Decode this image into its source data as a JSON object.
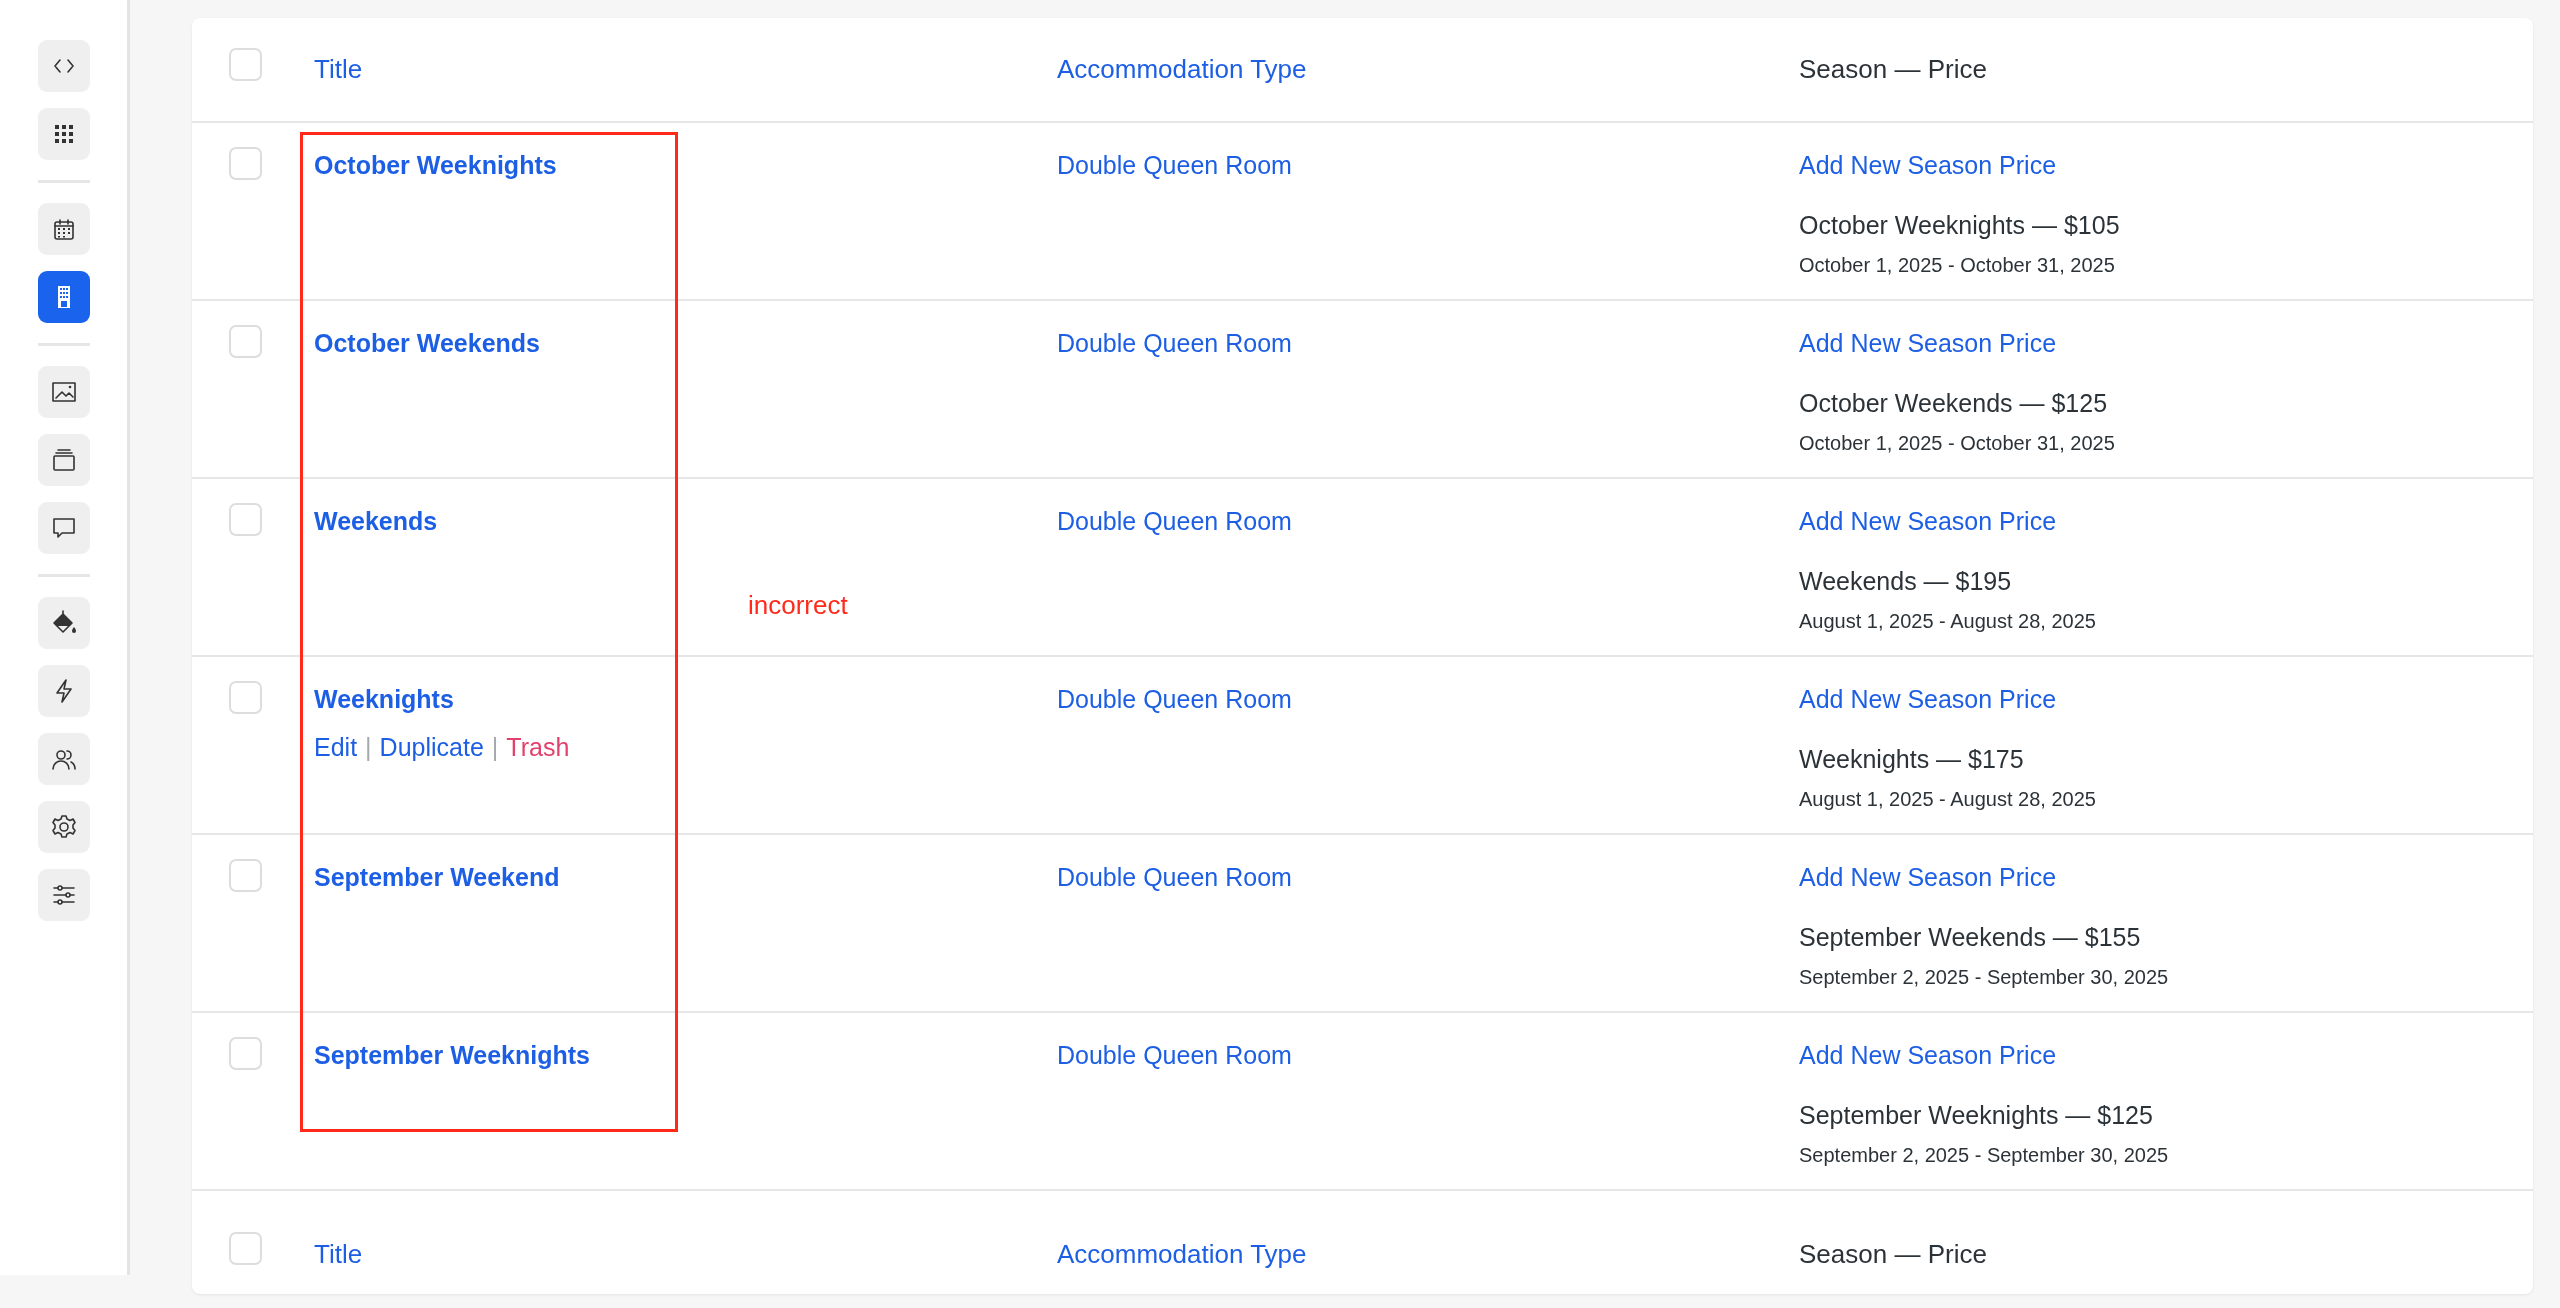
{
  "sidebar": {
    "groups": [
      [
        {
          "kind": "code",
          "selected": false
        },
        {
          "kind": "apps",
          "selected": false
        }
      ],
      [
        {
          "kind": "calendar",
          "selected": false
        },
        {
          "kind": "building",
          "selected": true
        }
      ],
      [
        {
          "kind": "image",
          "selected": false
        },
        {
          "kind": "stack",
          "selected": false
        },
        {
          "kind": "comment",
          "selected": false
        }
      ],
      [
        {
          "kind": "paint",
          "selected": false
        },
        {
          "kind": "bolt",
          "selected": false
        },
        {
          "kind": "users",
          "selected": false
        },
        {
          "kind": "settings",
          "selected": false
        },
        {
          "kind": "sliders",
          "selected": false
        }
      ]
    ]
  },
  "table": {
    "columns": [
      {
        "label": "Title",
        "sortable": true
      },
      {
        "label": "Accommodation Type",
        "sortable": true
      },
      {
        "label": "Season — Price",
        "sortable": false
      }
    ],
    "header_checked": false,
    "rows": [
      {
        "checked": false,
        "title": "October Weeknights",
        "actions": [],
        "accommodation": "Double Queen Room",
        "add_link": "Add New Season Price",
        "season_price": "October Weeknights — $105",
        "dates": "October 1, 2025 - October 31, 2025"
      },
      {
        "checked": false,
        "title": "October Weekends",
        "actions": [],
        "accommodation": "Double Queen Room",
        "add_link": "Add New Season Price",
        "season_price": "October Weekends — $125",
        "dates": "October 1, 2025 - October 31, 2025"
      },
      {
        "checked": false,
        "title": "Weekends",
        "actions": [],
        "accommodation": "Double Queen Room",
        "add_link": "Add New Season Price",
        "season_price": "Weekends — $195",
        "dates": "August 1, 2025 - August 28, 2025"
      },
      {
        "checked": false,
        "title": "Weeknights",
        "actions": [
          {
            "label": "Edit",
            "kind": "edit"
          },
          {
            "separator": "|",
            "label": "Duplicate",
            "kind": "duplicate"
          },
          {
            "separator": "|",
            "label": "Trash",
            "kind": "trash"
          }
        ],
        "accommodation": "Double Queen Room",
        "add_link": "Add New Season Price",
        "season_price": "Weeknights — $175",
        "dates": "August 1, 2025 - August 28, 2025"
      },
      {
        "checked": false,
        "title": "September Weekend",
        "actions": [],
        "accommodation": "Double Queen Room",
        "add_link": "Add New Season Price",
        "season_price": "September Weekends — $155",
        "dates": "September 2, 2025 - September 30, 2025"
      },
      {
        "checked": false,
        "title": "September Weeknights",
        "actions": [],
        "accommodation": "Double Queen Room",
        "add_link": "Add New Season Price",
        "season_price": "September Weeknights — $125",
        "dates": "September 2, 2025 - September 30, 2025"
      }
    ],
    "footer_checked": false,
    "footer_columns": [
      {
        "label": "Title",
        "sortable": true
      },
      {
        "label": "Accommodation Type",
        "sortable": true
      },
      {
        "label": "Season — Price",
        "sortable": false
      }
    ]
  },
  "annotation": {
    "label": "incorrect"
  }
}
